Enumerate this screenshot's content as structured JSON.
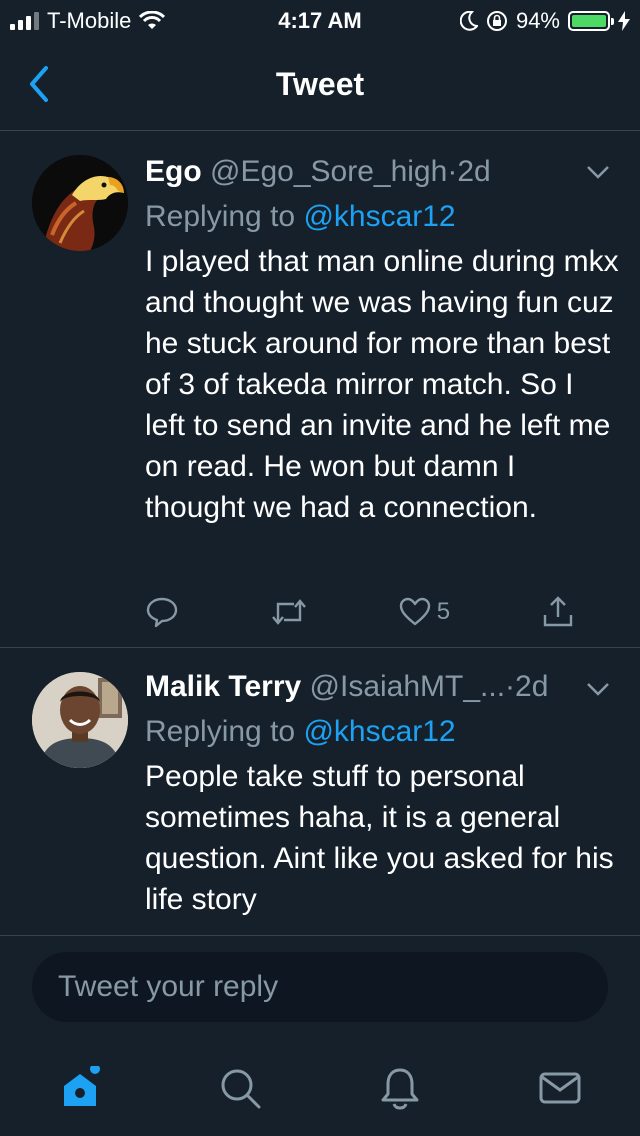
{
  "status_bar": {
    "carrier": "T-Mobile",
    "time": "4:17 AM",
    "battery": "94%",
    "battery_level": 0.94
  },
  "header": {
    "title": "Tweet"
  },
  "tweets": [
    {
      "display_name": "Ego",
      "handle": "@Ego_Sore_high",
      "separator": "·",
      "age": "2d",
      "replying_label": "Replying to",
      "replying_to": "@khscar12",
      "text": "I played that man online during mkx and thought we was having fun cuz he stuck around for more than best of 3 of takeda mirror match. So I left to send an invite and he left me on read. He won but damn I thought we had a connection.",
      "like_count": "5"
    },
    {
      "display_name": "Malik Terry",
      "handle": "@IsaiahMT_...",
      "separator": "·",
      "age": "2d",
      "replying_label": "Replying to",
      "replying_to": "@khscar12",
      "text": "People take stuff to personal sometimes haha, it is a general question. Aint like you asked for his life story"
    }
  ],
  "reply_box": {
    "placeholder": "Tweet your reply"
  },
  "tabbar": {
    "items": [
      "home-icon",
      "search-icon",
      "notifications-icon",
      "messages-icon"
    ],
    "active": "home-icon",
    "accent_color": "#1da1f2"
  },
  "colors": {
    "background": "#15202b",
    "muted_text": "#8899a6",
    "accent": "#1da1f2",
    "divider": "#38444d"
  }
}
